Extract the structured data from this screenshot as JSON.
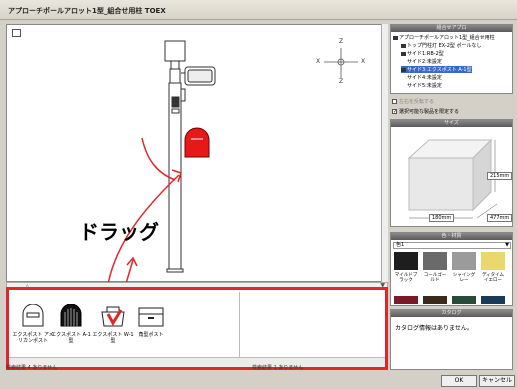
{
  "window": {
    "title": "アプローチポールアロット1型_組合せ用柱 TOEX"
  },
  "viewport": {
    "annotation": "ドラッグ",
    "compass": {
      "top": "Z",
      "left": "X",
      "right": "X",
      "bottom": "Z"
    }
  },
  "palette": {
    "items": [
      {
        "label": "エクスポスト アメリカンポスト",
        "icon": "arched-mailbox-white"
      },
      {
        "label": "エクスポスト A-1型",
        "icon": "arched-mailbox-black"
      },
      {
        "label": "エクスポスト W-1型",
        "icon": "mailbox-w1"
      },
      {
        "label": "角型ポスト",
        "icon": "square-mailbox"
      }
    ]
  },
  "status": {
    "left": "検索結果 4 ありません",
    "right": "検索結果 1 ありません"
  },
  "tree": {
    "header": "組合せアプロ",
    "items": [
      {
        "label": "アプローチポールアロット1型_組合せ用柱",
        "selected": false,
        "indent": 0
      },
      {
        "label": "トップ門柱灯 EX-2型 ポールなし",
        "selected": false,
        "indent": 1
      },
      {
        "label": "サイド1:RB-2型",
        "selected": false,
        "indent": 1
      },
      {
        "label": "サイド2:未設定",
        "selected": false,
        "indent": 1
      },
      {
        "label": "サイド3:エクスポスト A-1型",
        "selected": true,
        "indent": 1
      },
      {
        "label": "サイド4:未設定",
        "selected": false,
        "indent": 1
      },
      {
        "label": "サイド5:未設定",
        "selected": false,
        "indent": 1
      }
    ],
    "option1": "左右を反転する",
    "option2": "選択可能な製品を限定する"
  },
  "size_panel": {
    "header": "サイズ",
    "height": "215mm",
    "width": "180mm",
    "depth": "477mm"
  },
  "color_panel": {
    "header": "色・材質",
    "dropdown": "色1",
    "swatches": [
      {
        "label": "マイルドブラック",
        "color": "#1e1e1e"
      },
      {
        "label": "コールゴールド",
        "color": "#6a6a6a"
      },
      {
        "label": "シャイングレー",
        "color": "#9b9b9b"
      },
      {
        "label": "ディタイムイエロー",
        "color": "#e9d86b"
      }
    ],
    "extra_colors": [
      "#7a1a28",
      "#3a2a1a",
      "#2a4a3a",
      "#1a3a5a"
    ]
  },
  "catalog_panel": {
    "header": "カタログ",
    "message": "カタログ情報はありません。"
  },
  "buttons": {
    "ok": "OK",
    "cancel": "キャンセル"
  }
}
